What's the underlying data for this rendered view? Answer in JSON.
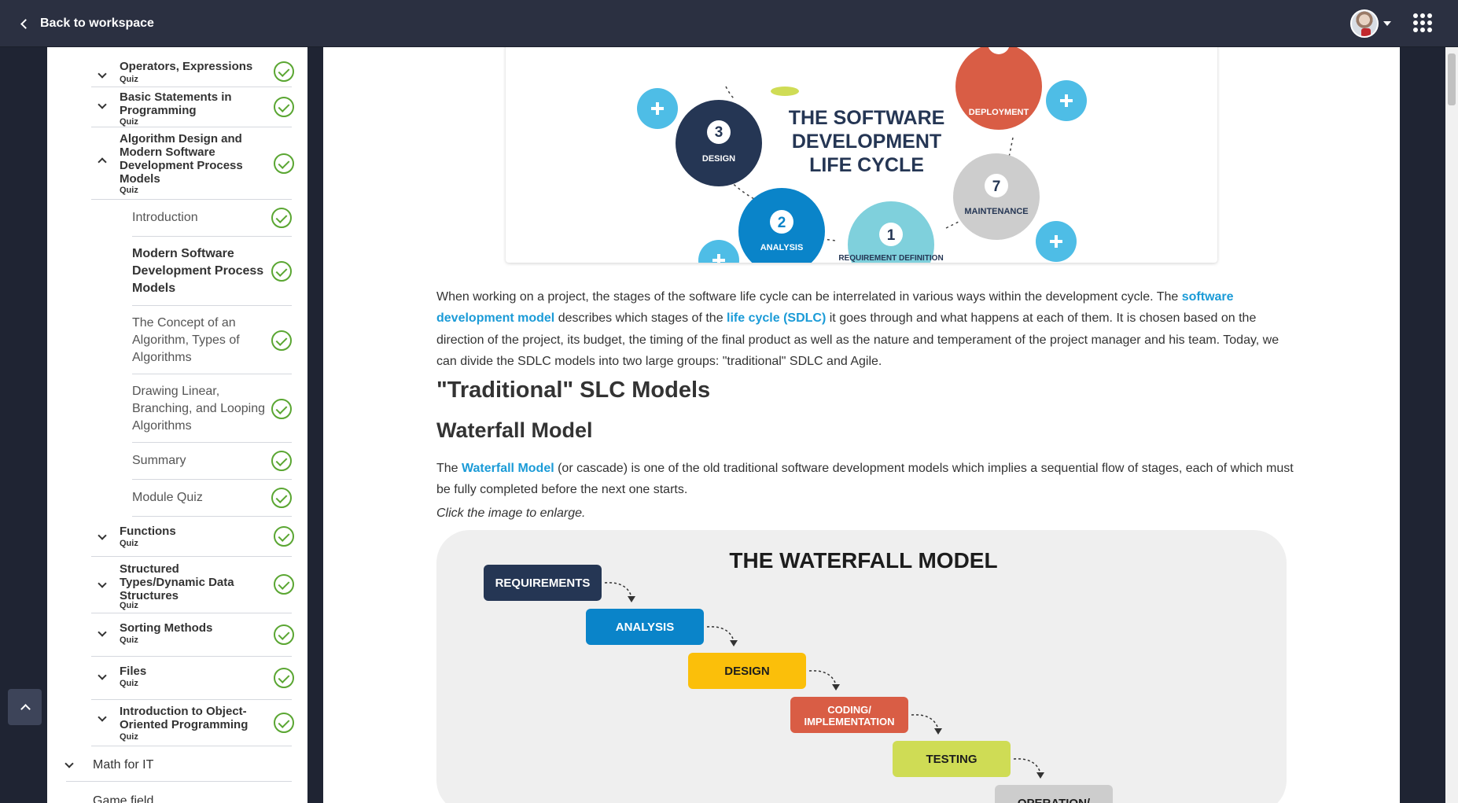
{
  "topbar": {
    "back_label": "Back to workspace"
  },
  "sidebar": {
    "modules_top": [
      {
        "title": "Operators, Expressions",
        "sub": "Quiz"
      },
      {
        "title": "Basic Statements in Programming",
        "sub": "Quiz"
      },
      {
        "title": "Algorithm Design and Modern Software Development Process Models",
        "sub": "Quiz"
      }
    ],
    "lessons": [
      {
        "title": "Introduction"
      },
      {
        "title": "Modern Software Development Process Models"
      },
      {
        "title": "The Concept of an Algorithm, Types of Algorithms"
      },
      {
        "title": "Drawing Linear, Branching, and Looping Algorithms"
      },
      {
        "title": "Summary"
      },
      {
        "title": "Module Quiz"
      }
    ],
    "modules_bottom": [
      {
        "title": "Functions",
        "sub": "Quiz"
      },
      {
        "title": "Structured Types/Dynamic Data Structures",
        "sub": "Quiz"
      },
      {
        "title": "Sorting Methods",
        "sub": "Quiz"
      },
      {
        "title": "Files",
        "sub": "Quiz"
      },
      {
        "title": "Introduction to Object-Oriented Programming",
        "sub": "Quiz"
      }
    ],
    "section": "Math for IT",
    "next_section": "Game field"
  },
  "sdlc": {
    "title_lines": [
      "THE SOFTWARE",
      "DEVELOPMENT",
      "LIFE CYCLE"
    ],
    "stages": [
      {
        "num": "3",
        "label": "DESIGN",
        "color": "#253654"
      },
      {
        "num": "2",
        "label": "ANALYSIS",
        "color": "#0a84c9"
      },
      {
        "num": "1",
        "label": "REQUIREMENT DEFINITION",
        "color": "#7fd0dc"
      },
      {
        "num": "7",
        "label": "MAINTENANCE",
        "color": "#cdcdcd"
      },
      {
        "num": "",
        "label": "DEPLOYMENT",
        "color": "#d95d45"
      }
    ],
    "plus_color": "#4ebde6"
  },
  "article": {
    "p1_a": "When working on a project, the stages of the software life cycle can be interrelated in various ways within the development cycle. The ",
    "p1_link1": "software development model",
    "p1_b": " describes which stages of the ",
    "p1_link2": "life cycle (SDLC)",
    "p1_c": " it goes through and what happens at each of them. It is chosen based on the direction of the project, its budget, the timing of the final product as well as the nature and temperament of the project manager and his team. Today, we can divide the SDLC models into two large groups: \"traditional\" SDLC and Agile.",
    "h_traditional": "\"Traditional\" SLC Models",
    "h_waterfall": "Waterfall Model",
    "p2_a": "The ",
    "p2_link": "Waterfall Model",
    "p2_b": " (or cascade) is one of the old traditional software development models which implies a sequential flow of stages, each of which must be fully completed before the next one starts.",
    "enlarge": "Click the image to enlarge."
  },
  "waterfall": {
    "title": "THE WATERFALL MODEL",
    "steps": [
      {
        "label": "REQUIREMENTS",
        "color": "#253654",
        "text_color": "#ffffff"
      },
      {
        "label": "ANALYSIS",
        "color": "#0a84c9",
        "text_color": "#ffffff"
      },
      {
        "label": "DESIGN",
        "color": "#fbbf0a",
        "text_color": "#1d1d1d"
      },
      {
        "label": "CODING/\nIMPLEMENTATION",
        "color": "#d95d45",
        "text_color": "#ffffff"
      },
      {
        "label": "TESTING",
        "color": "#cfdc55",
        "text_color": "#1d1d1d"
      },
      {
        "label": "OPERATION/",
        "color": "#cdcdcd",
        "text_color": "#1d1d1d"
      }
    ]
  }
}
